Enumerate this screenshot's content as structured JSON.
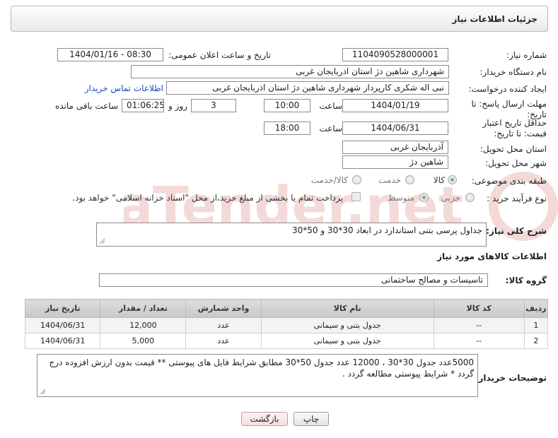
{
  "header": {
    "title": "جزئیات اطلاعات نیاز"
  },
  "form": {
    "need_number_label": "شماره نیاز:",
    "need_number": "1104090528000001",
    "announce_label": "تاریخ و ساعت اعلان عمومی:",
    "announce_value": "1404/01/16 - 08:30",
    "buyer_org_label": "نام دستگاه خریدار:",
    "buyer_org": "شهرداری شاهین دژ استان اذربایجان غربی",
    "creator_label": "ایجاد کننده درخواست:",
    "creator": "نبی اله شکری کارپرداز شهرداری شاهین دژ استان اذربایجان غربی",
    "buyer_contact_link": "اطلاعات تماس خریدار",
    "send_deadline_label": "مهلت ارسال پاسخ: تا تاریخ:",
    "send_deadline_date": "1404/01/19",
    "time_label": "ساعت",
    "send_deadline_time": "10:00",
    "days_value": "3",
    "days_label": "روز و",
    "remaining_time": "01:06:25",
    "remaining_label": "ساعت باقی مانده",
    "price_validity_label": "حداقل تاریخ اعتبار قیمت: تا تاریخ:",
    "price_validity_date": "1404/06/31",
    "price_validity_time": "18:00",
    "province_label": "استان محل تحویل:",
    "province": "آذربایجان غربی",
    "city_label": "شهر محل تحویل:",
    "city": "شاهین دژ",
    "category_label": "طبقه بندی موضوعی:",
    "category_options": [
      "کالا",
      "خدمت",
      "کالا/خدمت"
    ],
    "category_selected": "کالا",
    "process_label": "نوع فرآیند خرید :",
    "process_options": [
      "جزیی",
      "متوسط"
    ],
    "process_selected": "متوسط",
    "payment_note": "پرداخت تمام یا بخشی از مبلغ خرید،از محل \"اسناد خزانه اسلامی\" خواهد بود."
  },
  "description": {
    "label": "شرح کلی نیاز:",
    "value": "جداول پرسی بتنی استاندارد در ابعاد 30*30 و 50*30"
  },
  "goods": {
    "section_title": "اطلاعات کالاهای مورد نیاز",
    "group_label": "گروه کالا:",
    "group_value": "تاسیسات و مصالح ساختمانی",
    "columns": [
      "ردیف",
      "کد کالا",
      "نام کالا",
      "واحد شمارش",
      "تعداد / مقدار",
      "تاریخ نیاز"
    ],
    "rows": [
      {
        "index": "1",
        "code": "--",
        "name": "جدول بتنی و سیمانی",
        "unit": "عدد",
        "qty": "12,000",
        "date": "1404/06/31"
      },
      {
        "index": "2",
        "code": "--",
        "name": "جدول بتنی و سیمانی",
        "unit": "عدد",
        "qty": "5,000",
        "date": "1404/06/31"
      }
    ]
  },
  "buyer_notes": {
    "label": "توضیحات خریدار:",
    "value": "5000عدد جدول 30*30 ، 12000 عدد جدول 50*30  مطابق شرایط فایل های پیوستی ** قیمت بدون ارزش افزوده درج گردد * شرایط پیوستی مطالعه گردد ."
  },
  "buttons": {
    "print": "چاپ",
    "back": "بازگشت"
  },
  "watermark": {
    "text": "AriaTender.net"
  },
  "colors": {
    "link": "#1d4fb1",
    "back_button_bg": "#f3dede",
    "header_bg": "#e9e9e9"
  }
}
